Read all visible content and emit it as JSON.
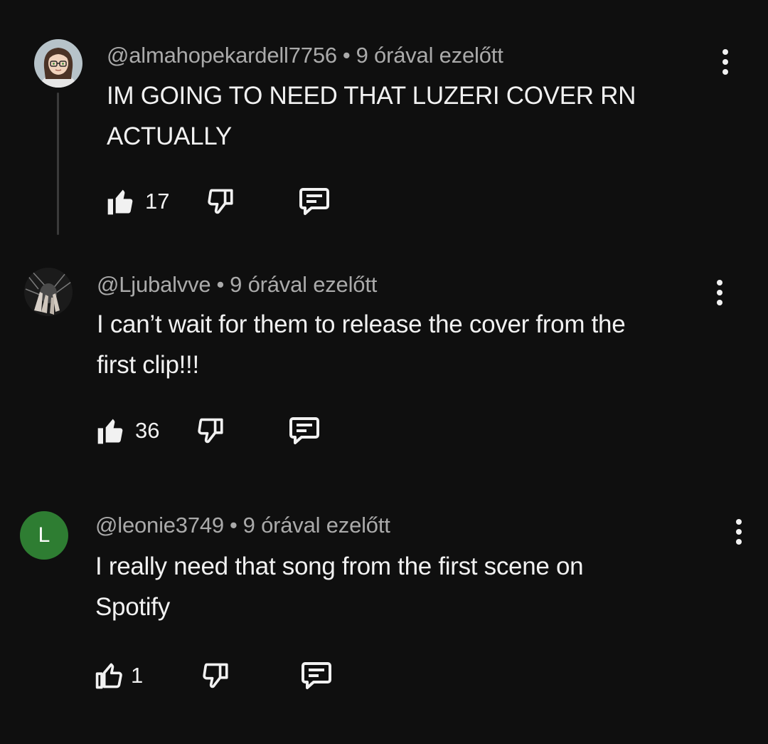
{
  "comments": [
    {
      "handle": "@almahopekardell7756",
      "separator": "•",
      "time": "9 órával ezelőtt",
      "text": "IM GOING TO NEED THAT LUZERI COVER RN\nACTUALLY",
      "likes": "17",
      "avatar": "cartoon-girl-with-glasses",
      "liked": true
    },
    {
      "handle": "@Ljubalvve",
      "separator": "•",
      "time": "9 órával ezelőtt",
      "text": "I can’t wait for them to release the cover from the\nfirst clip!!!",
      "likes": "36",
      "avatar": "dark-photo-hands",
      "liked": true
    },
    {
      "handle": "@leonie3749",
      "separator": "•",
      "time": "9 órával ezelőtt",
      "text": "I really need that song from the first scene on\nSpotify",
      "likes": "1",
      "avatar_letter": "L",
      "avatar_color": "#2e7d32",
      "liked": false
    }
  ],
  "icons": {
    "like": "thumbs-up-icon",
    "dislike": "thumbs-down-icon",
    "reply": "reply-comment-icon",
    "menu": "more-vertical-icon"
  }
}
